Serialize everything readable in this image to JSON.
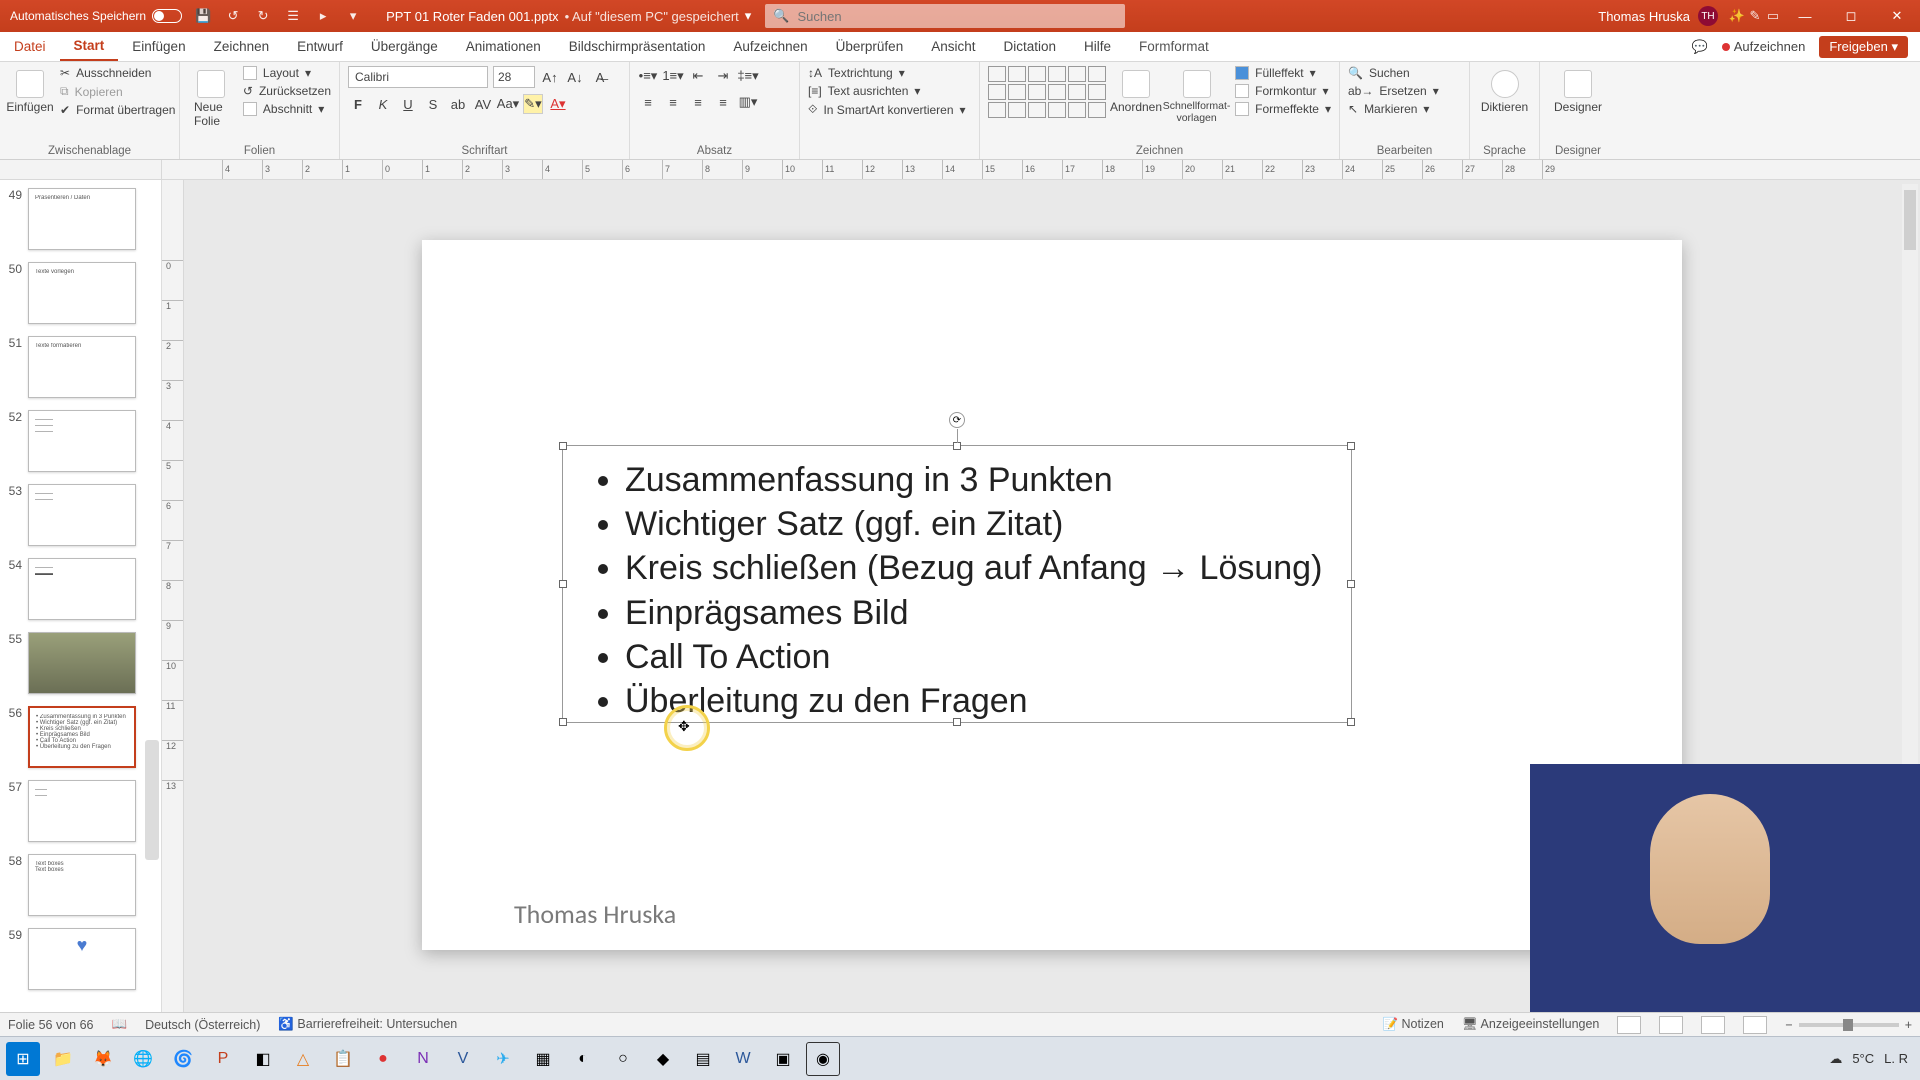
{
  "titlebar": {
    "autosave_label": "Automatisches Speichern",
    "filename": "PPT 01 Roter Faden 001.pptx",
    "saved_hint": "• Auf \"diesem PC\" gespeichert ",
    "search_placeholder": "Suchen",
    "user_name": "Thomas Hruska",
    "user_initials": "TH"
  },
  "tabs": {
    "file": "Datei",
    "items": [
      "Start",
      "Einfügen",
      "Zeichnen",
      "Entwurf",
      "Übergänge",
      "Animationen",
      "Bildschirmpräsentation",
      "Aufzeichnen",
      "Überprüfen",
      "Ansicht",
      "Dictation",
      "Hilfe",
      "Formformat"
    ],
    "active_index": 0,
    "record": "Aufzeichnen",
    "share": "Freigeben"
  },
  "ribbon": {
    "clipboard": {
      "paste": "Einfügen",
      "cut": "Ausschneiden",
      "copy": "Kopieren",
      "format_painter": "Format übertragen",
      "label": "Zwischenablage"
    },
    "slides": {
      "new": "Neue Folie",
      "layout": "Layout",
      "reset": "Zurücksetzen",
      "section": "Abschnitt",
      "label": "Folien"
    },
    "font": {
      "name": "Calibri",
      "size": "28",
      "label": "Schriftart"
    },
    "paragraph": {
      "label": "Absatz"
    },
    "drawing": {
      "textdir": "Textrichtung",
      "align": "Text ausrichten",
      "smartart": "In SmartArt konvertieren",
      "arrange": "Anordnen",
      "quick": "Schnellformat-vorlagen",
      "fill": "Fülleffekt",
      "outline": "Formkontur",
      "effects": "Formeffekte",
      "label": "Zeichnen"
    },
    "editing": {
      "find": "Suchen",
      "replace": "Ersetzen",
      "select": "Markieren",
      "label": "Bearbeiten"
    },
    "voice": {
      "dictate": "Diktieren",
      "label": "Sprache"
    },
    "designer": {
      "btn": "Designer",
      "label": "Designer"
    }
  },
  "thumbs": [
    {
      "n": "49",
      "lines": [
        "Präsentieren / Daten"
      ]
    },
    {
      "n": "50",
      "lines": [
        "Texte vorlegen"
      ]
    },
    {
      "n": "51",
      "lines": [
        "Texte formatieren"
      ]
    },
    {
      "n": "52",
      "lines": [
        "———",
        "———",
        "———"
      ]
    },
    {
      "n": "53",
      "lines": [
        "———",
        "———"
      ]
    },
    {
      "n": "54",
      "lines": [
        "———",
        "▬▬▬"
      ]
    },
    {
      "n": "55",
      "lines": []
    },
    {
      "n": "56",
      "lines": [
        "• Zusammenfassung in 3 Punkten",
        "• Wichtiger Satz (ggf. ein Zitat)",
        "• Kreis schließen",
        "• Einprägsames Bild",
        "• Call To Action",
        "• Überleitung zu den Fragen"
      ],
      "selected": true
    },
    {
      "n": "57",
      "lines": [
        "——",
        "——"
      ]
    },
    {
      "n": "58",
      "lines": [
        "Text boxes",
        "Text boxes"
      ]
    },
    {
      "n": "59",
      "lines": [
        "♥"
      ]
    }
  ],
  "slide": {
    "bullets": [
      "Zusammenfassung in 3 Punkten",
      "Wichtiger Satz (ggf. ein Zitat)",
      "Kreis schließen (Bezug auf Anfang → Lösung)",
      "Einprägsames Bild",
      "Call To Action",
      "Überleitung zu den Fragen"
    ],
    "footer": "Thomas Hruska"
  },
  "status": {
    "slide": "Folie 56 von 66",
    "lang": "Deutsch (Österreich)",
    "access": "Barrierefreiheit: Untersuchen",
    "notes": "Notizen",
    "display": "Anzeigeeinstellungen"
  },
  "tray": {
    "temp": "5°C",
    "label": "L. R"
  },
  "ruler_h": [
    "4",
    "3",
    "2",
    "1",
    "0",
    "1",
    "2",
    "3",
    "4",
    "5",
    "6",
    "7",
    "8",
    "9",
    "10",
    "11",
    "12",
    "13",
    "14",
    "15",
    "16",
    "17",
    "18",
    "19",
    "20",
    "21",
    "22",
    "23",
    "24",
    "25",
    "26",
    "27",
    "28",
    "29"
  ],
  "ruler_v": [
    "0",
    "1",
    "2",
    "3",
    "4",
    "5",
    "6",
    "7",
    "8",
    "9",
    "10",
    "11",
    "12",
    "13"
  ]
}
